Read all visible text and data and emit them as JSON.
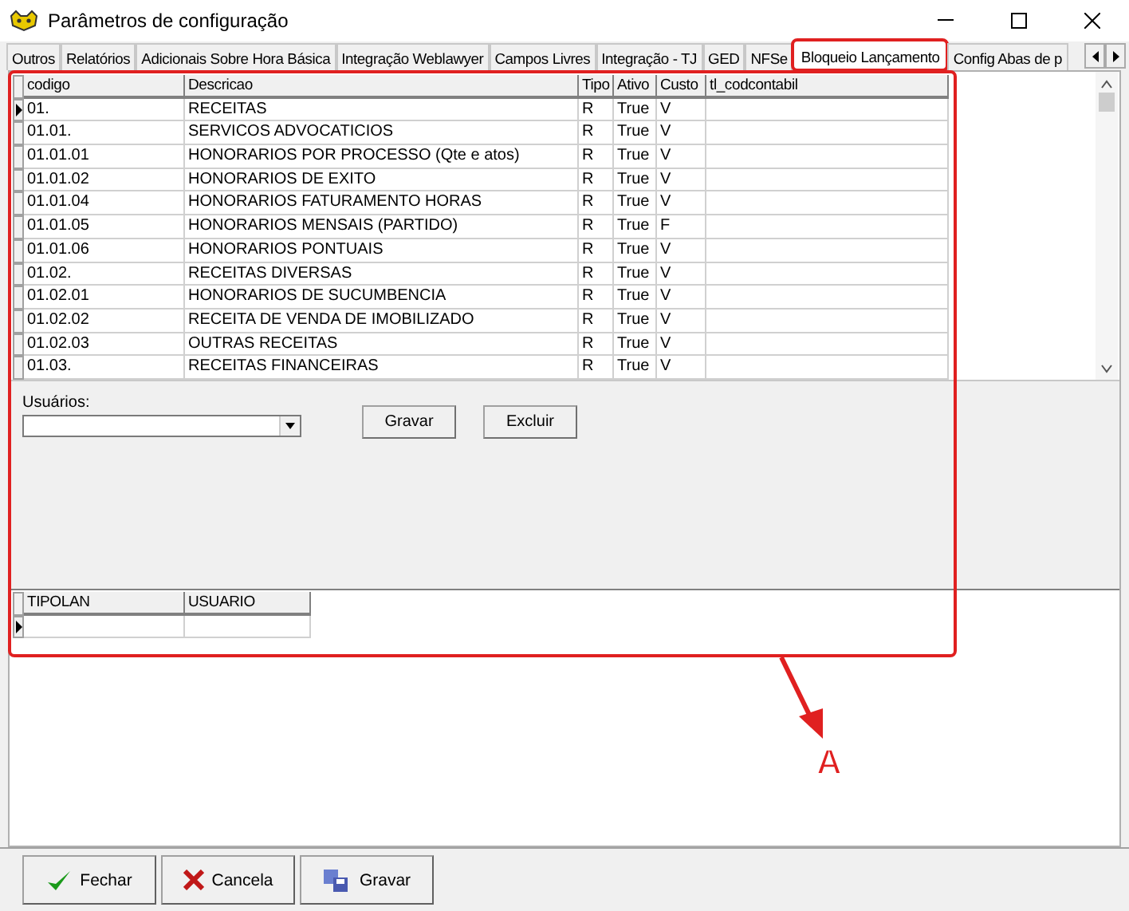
{
  "window": {
    "title": "Parâmetros de configuração"
  },
  "tabs": [
    {
      "label": "Outros",
      "selected": false
    },
    {
      "label": "Relatórios",
      "selected": false
    },
    {
      "label": "Adicionais Sobre Hora Básica",
      "selected": false
    },
    {
      "label": "Integração Weblawyer",
      "selected": false
    },
    {
      "label": "Campos Livres",
      "selected": false
    },
    {
      "label": "Integração - TJ",
      "selected": false
    },
    {
      "label": "GED",
      "selected": false
    },
    {
      "label": "NFSe",
      "selected": false
    },
    {
      "label": "Bloqueio Lançamento",
      "selected": true
    },
    {
      "label": "Config Abas de p",
      "selected": false
    }
  ],
  "top_grid": {
    "columns": [
      "codigo",
      "Descricao",
      "Tipo",
      "Ativo",
      "Custo",
      "tl_codcontabil"
    ],
    "rows": [
      {
        "selected": true,
        "cells": [
          "01.",
          "RECEITAS",
          "R",
          "True",
          "V"
        ]
      },
      {
        "selected": false,
        "cells": [
          "01.01.",
          "SERVICOS ADVOCATICIOS",
          "R",
          "True",
          "V"
        ]
      },
      {
        "selected": false,
        "cells": [
          "01.01.01",
          "HONORARIOS POR PROCESSO (Qte e atos)",
          "R",
          "True",
          "V"
        ]
      },
      {
        "selected": false,
        "cells": [
          "01.01.02",
          "HONORARIOS DE EXITO",
          "R",
          "True",
          "V"
        ]
      },
      {
        "selected": false,
        "cells": [
          "01.01.04",
          "HONORARIOS FATURAMENTO HORAS",
          "R",
          "True",
          "V"
        ]
      },
      {
        "selected": false,
        "cells": [
          "01.01.05",
          "HONORARIOS MENSAIS (PARTIDO)",
          "R",
          "True",
          "F"
        ]
      },
      {
        "selected": false,
        "cells": [
          "01.01.06",
          "HONORARIOS PONTUAIS",
          "R",
          "True",
          "V"
        ]
      },
      {
        "selected": false,
        "cells": [
          "01.02.",
          "RECEITAS DIVERSAS",
          "R",
          "True",
          "V"
        ]
      },
      {
        "selected": false,
        "cells": [
          "01.02.01",
          "HONORARIOS DE SUCUMBENCIA",
          "R",
          "True",
          "V"
        ]
      },
      {
        "selected": false,
        "cells": [
          "01.02.02",
          "RECEITA DE VENDA DE IMOBILIZADO",
          "R",
          "True",
          "V"
        ]
      },
      {
        "selected": false,
        "cells": [
          "01.02.03",
          "OUTRAS RECEITAS",
          "R",
          "True",
          "V"
        ]
      },
      {
        "selected": false,
        "cells": [
          "01.03.",
          "RECEITAS FINANCEIRAS",
          "R",
          "True",
          "V"
        ]
      }
    ]
  },
  "form": {
    "usuarios_label": "Usuários:",
    "buttons": [
      "Gravar",
      "Excluir"
    ]
  },
  "bottom_grid": {
    "columns": [
      "TIPOLAN",
      "USUARIO"
    ],
    "rows": [
      {
        "selected": true
      }
    ]
  },
  "footer_buttons": [
    {
      "kind": "check",
      "label": "Fechar"
    },
    {
      "kind": "cross",
      "label": "Cancela"
    },
    {
      "kind": "save",
      "label": "Gravar"
    }
  ],
  "annotation": {
    "label": "A"
  }
}
